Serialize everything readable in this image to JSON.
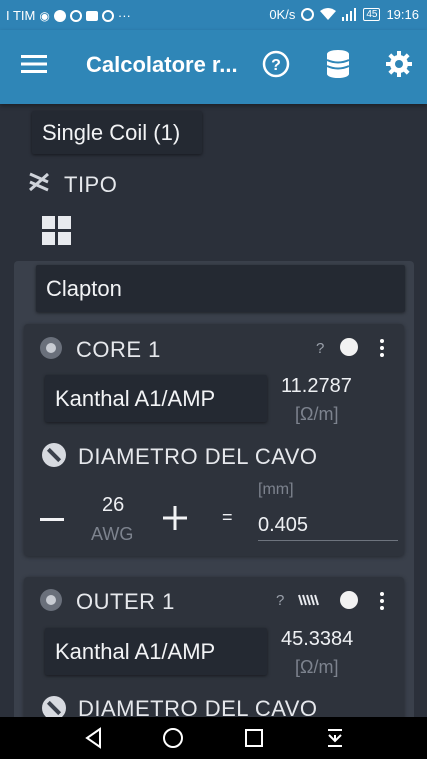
{
  "status_bar": {
    "carrier": "I TIM",
    "speed": "0K/s",
    "battery": "45",
    "time": "19:16"
  },
  "app_bar": {
    "title": "Calcolatore r...",
    "icons": [
      "menu-icon",
      "help-icon",
      "coil-database-icon",
      "settings-icon"
    ]
  },
  "coil_selector": "Single Coil (1)",
  "tipo": {
    "label": "TIPO",
    "value": "Clapton"
  },
  "wires": [
    {
      "name": "CORE 1",
      "help": "?",
      "material": "Kanthal A1/AMP",
      "resistance": "11.2787",
      "resistance_unit": "[Ω/m]",
      "diameter_label": "DIAMETRO DEL CAVO",
      "awg_value": "26",
      "awg_unit": "AWG",
      "equals": "=",
      "mm_unit": "[mm]",
      "mm_value": "0.405"
    },
    {
      "name": "OUTER 1",
      "help": "?",
      "material": "Kanthal A1/AMP",
      "resistance": "45.3384",
      "resistance_unit": "[Ω/m]",
      "diameter_label": "DIAMETRO DEL CAVO"
    }
  ],
  "colors": {
    "app_bar": "#2f86b7",
    "background": "#2b303a",
    "card": "#2e333c",
    "panel": "#3a404b"
  }
}
